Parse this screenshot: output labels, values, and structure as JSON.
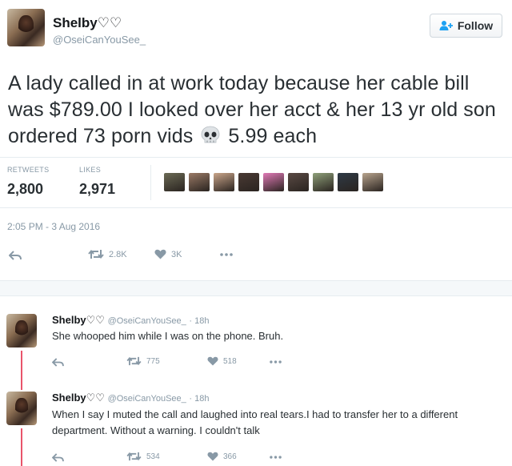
{
  "main_tweet": {
    "name": "Shelby♡♡",
    "handle": "@OseiCanYouSee_",
    "follow_label": "Follow",
    "text_before": "A lady called in at work today because her cable bill was $789.00 I looked over her acct & her 13 yr old son ordered 73 porn vids",
    "text_after": "5.99 each",
    "retweets_label": "RETWEETS",
    "retweets_value": "2,800",
    "likes_label": "LIKES",
    "likes_value": "2,971",
    "timestamp": "2:05 PM - 3 Aug 2016",
    "actions": {
      "retweet_count": "2.8K",
      "like_count": "3K"
    },
    "liker_colors": [
      "#6b6a55",
      "#9a7a66",
      "#c9a58a",
      "#4a3a34",
      "#e07ab6",
      "#5a4a44",
      "#8fa07a",
      "#2f3a46",
      "#b8a48e"
    ]
  },
  "replies": [
    {
      "name": "Shelby♡♡",
      "handle": "@OseiCanYouSee_",
      "time": "· 18h",
      "text": "She whooped him while I was on the phone. Bruh.",
      "retweet_count": "775",
      "like_count": "518"
    },
    {
      "name": "Shelby♡♡",
      "handle": "@OseiCanYouSee_",
      "time": "· 18h",
      "text": "When I say I muted the call and laughed into real tears.I had to transfer her to a different department. Without a warning. I couldn't talk",
      "retweet_count": "534",
      "like_count": "366"
    }
  ],
  "colors": {
    "accent_blue": "#1da1f2",
    "thread_line": "#e9546b",
    "muted": "#8899a6"
  }
}
